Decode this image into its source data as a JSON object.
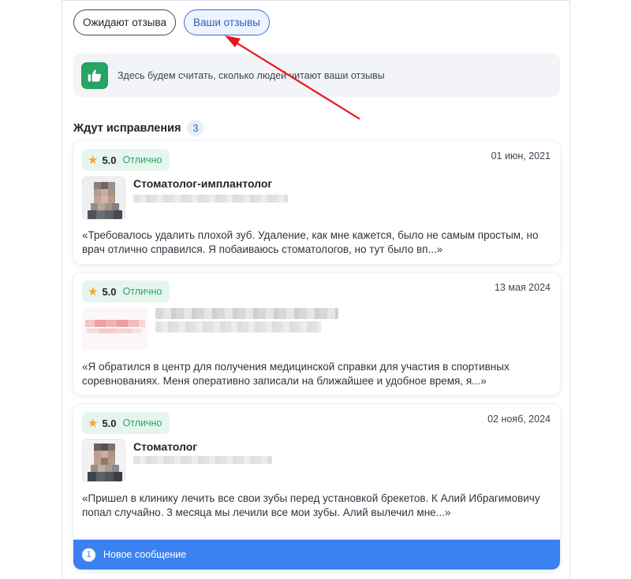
{
  "tabs": [
    {
      "label": "Ожидают отзыва",
      "active": false
    },
    {
      "label": "Ваши отзывы",
      "active": true
    }
  ],
  "info": {
    "icon": "thumbs-up-icon",
    "text": "Здесь будем считать, сколько людей читают ваши отзывы"
  },
  "section": {
    "title": "Ждут исправления",
    "count": "3"
  },
  "reviews": [
    {
      "rating": "5.0",
      "rating_word": "Отлично",
      "date": "01 июн, 2021",
      "doctor_title": "Стоматолог-имплантолог",
      "text": "«Требовалось удалить плохой зуб. Удаление, как мне кажется, было не самым простым, но врач отлично справился. Я побаиваюсь стоматологов, но тут было вп...»"
    },
    {
      "rating": "5.0",
      "rating_word": "Отлично",
      "date": "13 мая 2024",
      "doctor_title": "",
      "text": "«Я обратился в центр для получения медицинской справки для участия в спортивных соревнованиях. Меня оперативно записали на ближайшее и удобное время, я...»"
    },
    {
      "rating": "5.0",
      "rating_word": "Отлично",
      "date": "02 нояб, 2024",
      "doctor_title": "Стоматолог",
      "text": "«Пришел в клинику лечить все свои зубы перед установкой брекетов. К Алий Ибрагимовичу попал случайно. 3 месяца мы лечили все мои зубы. Алий вылечил мне...»",
      "notification": {
        "count": "1",
        "text": "Новое сообщение"
      }
    }
  ],
  "colors": {
    "accent_blue": "#3b82f0",
    "green": "#25a463",
    "annotation_red": "#e8141b"
  }
}
